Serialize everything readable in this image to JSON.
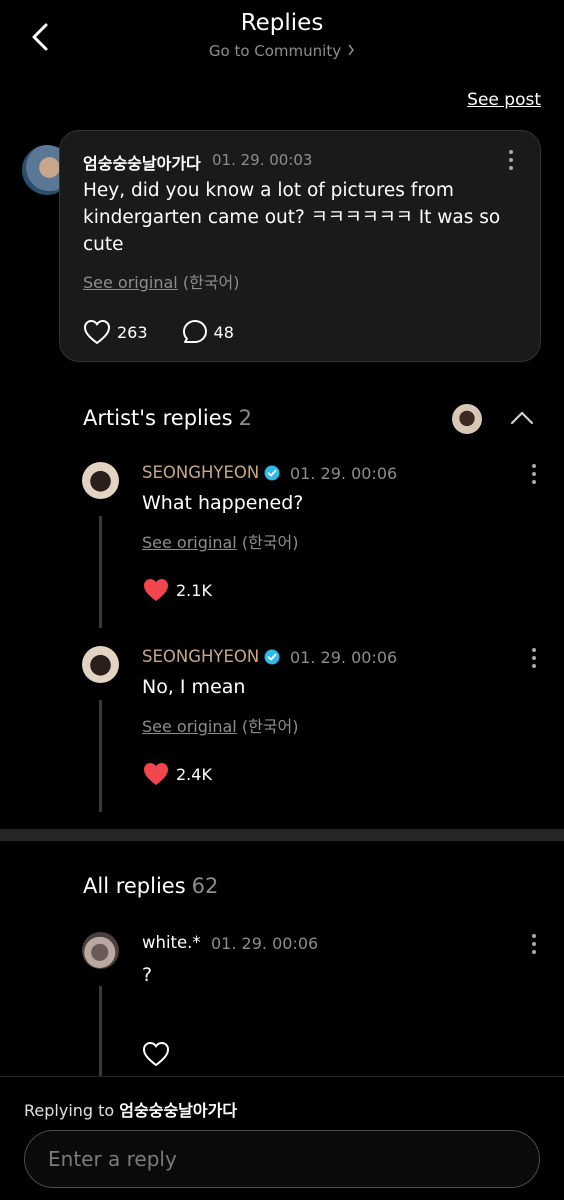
{
  "header": {
    "title": "Replies",
    "subtitle": "Go to Community",
    "see_post": "See post"
  },
  "post": {
    "author": "엄숭숭숭날아가다",
    "date": "01. 29. 00:03",
    "text": "Hey, did you know a lot of pictures from kindergarten came out? ㅋㅋㅋㅋㅋㅋ It was so cute",
    "see_original": "See original",
    "language": "(한국어)",
    "likes": "263",
    "comments": "48"
  },
  "artist_replies": {
    "title": "Artist's replies",
    "count": "2",
    "items": [
      {
        "author": "SEONGHYEON",
        "date": "01. 29. 00:06",
        "text": "What happened?",
        "see_original": "See original",
        "language": "(한국어)",
        "likes": "2.1K"
      },
      {
        "author": "SEONGHYEON",
        "date": "01. 29. 00:06",
        "text": "No, I mean",
        "see_original": "See original",
        "language": "(한국어)",
        "likes": "2.4K"
      }
    ]
  },
  "all_replies": {
    "title": "All replies",
    "count": "62",
    "items": [
      {
        "author": "white.*",
        "date": "01. 29. 00:06",
        "text": "?"
      }
    ]
  },
  "composer": {
    "replying_prefix": "Replying to",
    "replying_to": "엄숭숭숭날아가다",
    "placeholder": "Enter a reply"
  },
  "colors": {
    "background": "#000000",
    "card": "#1a1a1a",
    "muted_text": "#8d8d8d",
    "artist_name": "#c8a88a",
    "liked_heart": "#f0474f",
    "verified_badge": "#2fb8e8"
  },
  "icons": [
    "back-arrow-icon",
    "chevron-right-icon",
    "more-vertical-icon",
    "heart-outline-icon",
    "comment-bubble-icon",
    "chevron-up-icon",
    "verified-badge-icon",
    "heart-filled-icon"
  ]
}
